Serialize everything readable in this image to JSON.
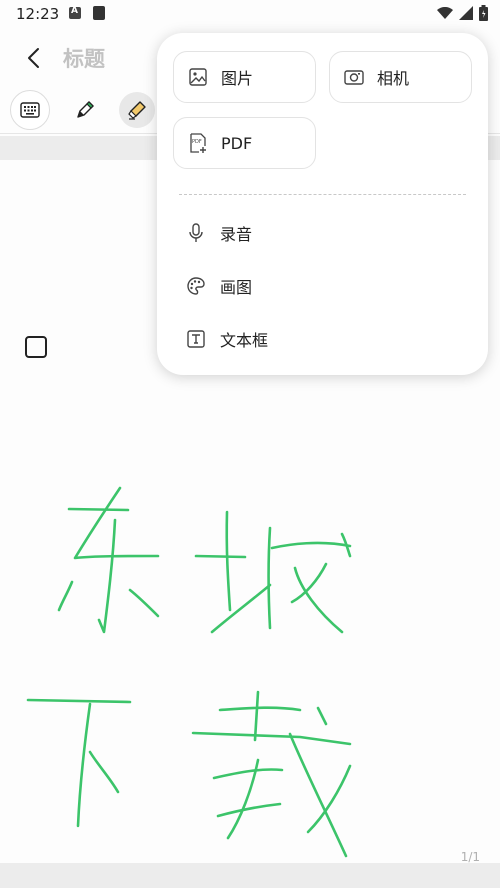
{
  "status_bar": {
    "time": "12:23"
  },
  "header": {
    "title_placeholder": "标题"
  },
  "insert_menu": {
    "image_label": "图片",
    "camera_label": "相机",
    "pdf_label": "PDF",
    "record_label": "录音",
    "draw_label": "画图",
    "textbox_label": "文本框"
  },
  "page_indicator": "1/1",
  "colors": {
    "ink": "#3cc46a",
    "accent": "#e8e8e8",
    "pen_tip": "#2fb35a",
    "highlighter": "#f2c96b"
  },
  "icons": [
    "keyboard-icon",
    "pen-icon",
    "highlighter-icon",
    "image-icon",
    "camera-icon",
    "pdf-icon",
    "microphone-icon",
    "palette-icon",
    "textbox-icon",
    "back-icon"
  ]
}
